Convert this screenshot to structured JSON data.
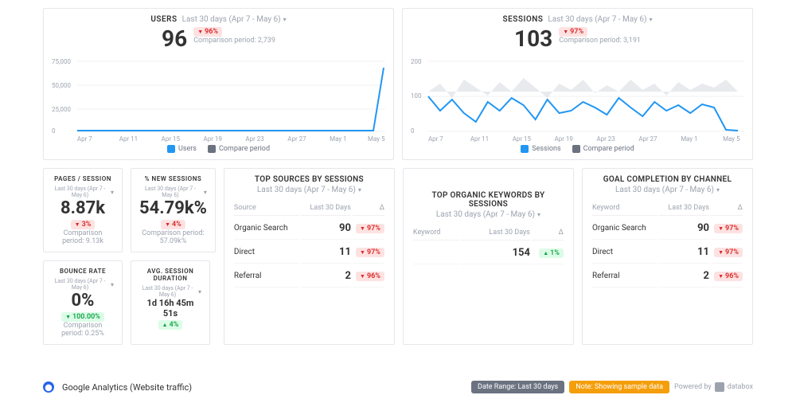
{
  "date_range": "Last 30 days (Apr 7 - May 6)",
  "users": {
    "title": "USERS",
    "value": "96",
    "delta": "96%",
    "comparison": "Comparison period: 2,739",
    "legend_a": "Users",
    "legend_b": "Compare period"
  },
  "sessions": {
    "title": "SESSIONS",
    "value": "103",
    "delta": "97%",
    "comparison": "Comparison period: 3,191",
    "legend_a": "Sessions",
    "legend_b": "Compare period"
  },
  "pages_session": {
    "title": "PAGES / SESSION",
    "value": "8.87k",
    "delta": "3%",
    "comp": "Comparison period: 9.13k"
  },
  "new_sessions": {
    "title": "% NEW SESSIONS",
    "value": "54.79k%",
    "delta": "4%",
    "comp": "Comparison period: 57.09k%"
  },
  "bounce": {
    "title": "BOUNCE RATE",
    "value": "0%",
    "delta": "100.00%",
    "comp": "Comparison period: 0.25%"
  },
  "avg_dur": {
    "title": "AVG. SESSION DURATION",
    "value": "1d 16h 45m 51s",
    "delta": "4%"
  },
  "top_sources": {
    "title": "TOP SOURCES BY SESSIONS",
    "cols": [
      "Source",
      "Last 30 Days",
      "Δ"
    ],
    "rows": [
      {
        "k": "Organic Search",
        "v": "90",
        "d": "97%"
      },
      {
        "k": "Direct",
        "v": "11",
        "d": "97%"
      },
      {
        "k": "Referral",
        "v": "2",
        "d": "96%"
      }
    ]
  },
  "organic_kw": {
    "title": "TOP ORGANIC KEYWORDS BY SESSIONS",
    "cols": [
      "Keyword",
      "Last 30 Days",
      "Δ"
    ],
    "value": "154",
    "delta": "1%"
  },
  "goal": {
    "title": "GOAL COMPLETION BY CHANNEL",
    "cols": [
      "Keyword",
      "Last 30 Days",
      "Δ"
    ],
    "rows": [
      {
        "k": "Organic Search",
        "v": "90",
        "d": "97%"
      },
      {
        "k": "Direct",
        "v": "11",
        "d": "97%"
      },
      {
        "k": "Referral",
        "v": "2",
        "d": "96%"
      }
    ]
  },
  "footer": {
    "source": "Google Analytics (Website traffic)",
    "range_label": "Date Range:",
    "range_value": "Last 30 days",
    "note": "Note: Showing sample data",
    "powered": "Powered by",
    "brand": "databox"
  },
  "chart_data": [
    {
      "type": "line",
      "title": "Users",
      "xlabel": "",
      "ylabel": "",
      "ylim": [
        0,
        75000
      ],
      "x_ticks": [
        "Apr 7",
        "Apr 11",
        "Apr 15",
        "Apr 19",
        "Apr 23",
        "Apr 27",
        "May 1",
        "May 5"
      ],
      "categories": [
        "Apr 7",
        "Apr 8",
        "Apr 9",
        "Apr 10",
        "Apr 11",
        "Apr 12",
        "Apr 13",
        "Apr 14",
        "Apr 15",
        "Apr 16",
        "Apr 17",
        "Apr 18",
        "Apr 19",
        "Apr 20",
        "Apr 21",
        "Apr 22",
        "Apr 23",
        "Apr 24",
        "Apr 25",
        "Apr 26",
        "Apr 27",
        "Apr 28",
        "Apr 29",
        "Apr 30",
        "May 1",
        "May 2",
        "May 3",
        "May 4",
        "May 5",
        "May 6"
      ],
      "series": [
        {
          "name": "Users",
          "values": [
            3,
            3,
            3,
            4,
            3,
            3,
            3,
            3,
            3,
            3,
            3,
            3,
            3,
            3,
            3,
            3,
            3,
            3,
            3,
            3,
            3,
            3,
            3,
            3,
            4,
            3,
            3,
            3,
            3,
            63000
          ]
        },
        {
          "name": "Compare period",
          "values": [
            95,
            90,
            92,
            88,
            95,
            92,
            90,
            88,
            92,
            90,
            95,
            92,
            88,
            90,
            92,
            88,
            95,
            90,
            92,
            88,
            90,
            92,
            88,
            95,
            90,
            92,
            88,
            90,
            92,
            90
          ]
        }
      ]
    },
    {
      "type": "line",
      "title": "Sessions",
      "xlabel": "",
      "ylabel": "",
      "ylim": [
        0,
        200
      ],
      "x_ticks": [
        "Apr 7",
        "Apr 11",
        "Apr 15",
        "Apr 19",
        "Apr 23",
        "Apr 27",
        "May 1",
        "May 5"
      ],
      "categories": [
        "Apr 7",
        "Apr 8",
        "Apr 9",
        "Apr 10",
        "Apr 11",
        "Apr 12",
        "Apr 13",
        "Apr 14",
        "Apr 15",
        "Apr 16",
        "Apr 17",
        "Apr 18",
        "Apr 19",
        "Apr 20",
        "Apr 21",
        "Apr 22",
        "Apr 23",
        "Apr 24",
        "Apr 25",
        "Apr 26",
        "Apr 27",
        "May 1",
        "May 2",
        "May 3",
        "May 4",
        "May 5",
        "May 6"
      ],
      "series": [
        {
          "name": "Sessions",
          "values": [
            100,
            60,
            90,
            55,
            30,
            85,
            60,
            95,
            75,
            35,
            90,
            55,
            60,
            85,
            70,
            50,
            95,
            70,
            45,
            85,
            60,
            75,
            55,
            78,
            70,
            5,
            3
          ]
        },
        {
          "name": "Compare period",
          "values": [
            110,
            130,
            95,
            140,
            120,
            100,
            135,
            110,
            145,
            120,
            95,
            130,
            115,
            140,
            105,
            125,
            110,
            140,
            115,
            130,
            100,
            135,
            115,
            130,
            120,
            140,
            110
          ]
        }
      ]
    }
  ]
}
